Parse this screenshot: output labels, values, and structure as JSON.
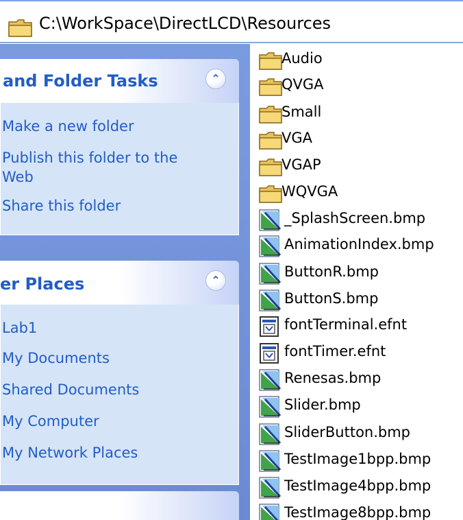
{
  "address_bar": {
    "path": "C:\\WorkSpace\\DirectLCD\\Resources",
    "icon": "folder-icon"
  },
  "task_pane": {
    "groups": [
      {
        "title": "and Folder Tasks",
        "toggle_icon": "chevron-up-double-icon",
        "links": [
          "Make a new folder",
          "Publish this folder to the",
          "Web",
          "Share this folder"
        ]
      },
      {
        "title": "er Places",
        "toggle_icon": "chevron-up-double-icon",
        "links": [
          "Lab1",
          "My Documents",
          "Shared Documents",
          "My Computer",
          "My Network Places"
        ]
      }
    ]
  },
  "files": [
    {
      "name": "Audio",
      "type": "folder"
    },
    {
      "name": "QVGA",
      "type": "folder"
    },
    {
      "name": "Small",
      "type": "folder"
    },
    {
      "name": "VGA",
      "type": "folder"
    },
    {
      "name": "VGAP",
      "type": "folder"
    },
    {
      "name": "WQVGA",
      "type": "folder"
    },
    {
      "name": "_SplashScreen.bmp",
      "type": "bmp"
    },
    {
      "name": "AnimationIndex.bmp",
      "type": "bmp"
    },
    {
      "name": "ButtonR.bmp",
      "type": "bmp"
    },
    {
      "name": "ButtonS.bmp",
      "type": "bmp"
    },
    {
      "name": "fontTerminal.efnt",
      "type": "efnt"
    },
    {
      "name": "fontTimer.efnt",
      "type": "efnt"
    },
    {
      "name": "Renesas.bmp",
      "type": "bmp"
    },
    {
      "name": "Slider.bmp",
      "type": "bmp"
    },
    {
      "name": "SliderButton.bmp",
      "type": "bmp"
    },
    {
      "name": "TestImage1bpp.bmp",
      "type": "bmp"
    },
    {
      "name": "TestImage4bpp.bmp",
      "type": "bmp"
    },
    {
      "name": "TestImage8bpp.bmp",
      "type": "bmp"
    }
  ],
  "colors": {
    "pane_background": "#6f8fd6",
    "link": "#215dc6",
    "group_body": "#d6e4f8"
  }
}
